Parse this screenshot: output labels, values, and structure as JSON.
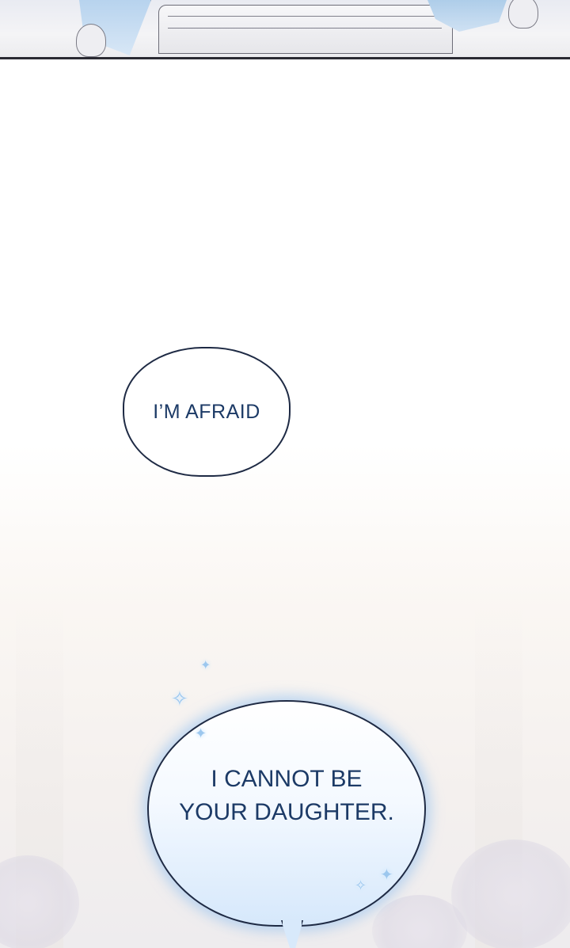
{
  "panels": {
    "top": {
      "description_icon": "comic-panel-table-scene"
    }
  },
  "bubbles": [
    {
      "text": "I’M AFRAID"
    },
    {
      "line1": "I CANNOT BE",
      "line2": "YOUR DAUGHTER."
    }
  ],
  "colors": {
    "text": "#1c3a66",
    "bubble_outline": "#1e2a44",
    "glow": "#8cbef0"
  },
  "sparkles": [
    "✦",
    "✧",
    "✦",
    "✧",
    "✦"
  ]
}
